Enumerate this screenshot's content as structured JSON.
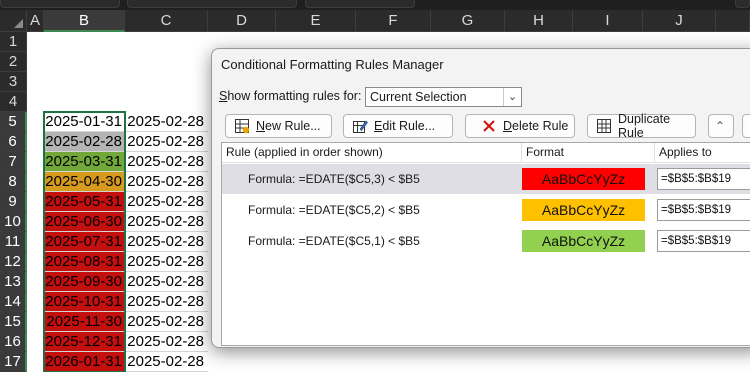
{
  "columns": [
    "A",
    "B",
    "C",
    "D",
    "E",
    "F",
    "G",
    "H",
    "I",
    "J"
  ],
  "rows": [
    "1",
    "2",
    "3",
    "4",
    "5",
    "6",
    "7",
    "8",
    "9",
    "10",
    "11",
    "12",
    "13",
    "14",
    "15",
    "16",
    "17"
  ],
  "col_b": [
    {
      "text": "2025-01-31",
      "fill": "#ffffff"
    },
    {
      "text": "2025-02-28",
      "fill": "#b4b4b4"
    },
    {
      "text": "2025-03-31",
      "fill": "#72a83a"
    },
    {
      "text": "2025-04-30",
      "fill": "#d69a1e"
    },
    {
      "text": "2025-05-31",
      "fill": "#c40f0f"
    },
    {
      "text": "2025-06-30",
      "fill": "#c40f0f"
    },
    {
      "text": "2025-07-31",
      "fill": "#c40f0f"
    },
    {
      "text": "2025-08-31",
      "fill": "#c40f0f"
    },
    {
      "text": "2025-09-30",
      "fill": "#c40f0f"
    },
    {
      "text": "2025-10-31",
      "fill": "#c40f0f"
    },
    {
      "text": "2025-11-30",
      "fill": "#c40f0f"
    },
    {
      "text": "2025-12-31",
      "fill": "#c40f0f"
    },
    {
      "text": "2026-01-31",
      "fill": "#c40f0f"
    }
  ],
  "col_c": [
    "2025-02-28",
    "2025-02-28",
    "2025-02-28",
    "2025-02-28",
    "2025-02-28",
    "2025-02-28",
    "2025-02-28",
    "2025-02-28",
    "2025-02-28",
    "2025-02-28",
    "2025-02-28",
    "2025-02-28",
    "2025-02-28"
  ],
  "dialog": {
    "title": "Conditional Formatting Rules Manager",
    "show_label_accel": "S",
    "show_label_rest": "how formatting rules for:",
    "scope_value": "Current Selection",
    "buttons": {
      "new_accel": "N",
      "new_rest": "ew Rule...",
      "edit_accel": "E",
      "edit_rest": "dit Rule...",
      "delete_accel": "D",
      "delete_rest": "elete Rule",
      "duplicate_label": "Duplicate Rule"
    },
    "headers": {
      "rule": "Rule (applied in order shown)",
      "format": "Format",
      "applies": "Applies to"
    },
    "rules": [
      {
        "formula": "Formula: =EDATE($C5,3) < $B5",
        "sample": "AaBbCcYyZz",
        "color": "#ff0000",
        "applies": "=$B$5:$B$19"
      },
      {
        "formula": "Formula: =EDATE($C5,2) < $B5",
        "sample": "AaBbCcYyZz",
        "color": "#ffc000",
        "applies": "=$B$5:$B$19"
      },
      {
        "formula": "Formula: =EDATE($C5,1) < $B5",
        "sample": "AaBbCcYyZz",
        "color": "#92d050",
        "applies": "=$B$5:$B$19"
      }
    ]
  },
  "colors": {
    "selection_border": "#1e7145",
    "header_bg": "#2b2b2b"
  }
}
